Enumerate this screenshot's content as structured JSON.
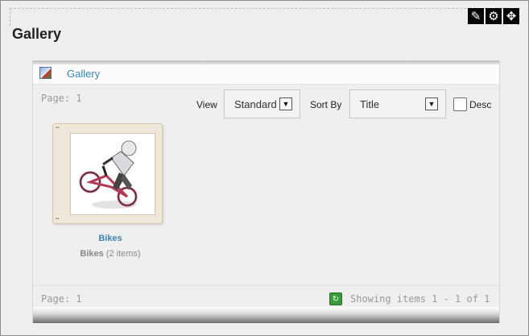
{
  "section": {
    "title": "Gallery"
  },
  "tools": [
    {
      "name": "edit",
      "icon": "pencil-icon",
      "glyph": "✎"
    },
    {
      "name": "settings",
      "icon": "gear-icon",
      "glyph": "⚙"
    },
    {
      "name": "move",
      "icon": "move-icon",
      "glyph": "✥"
    }
  ],
  "breadcrumb": {
    "label": "Gallery",
    "icon": "picture-icon"
  },
  "pager": {
    "top_label": "Page: 1",
    "bottom_label": "Page: 1",
    "showing": "Showing items 1 - 1 of 1"
  },
  "toolbar": {
    "view_label": "View",
    "view_value": "Standard",
    "sort_label": "Sort By",
    "sort_value": "Title",
    "desc_label": "Desc",
    "desc_checked": false
  },
  "items": [
    {
      "name": "Bikes",
      "caption_bold": "Bikes",
      "caption_rest": "(2 items)"
    }
  ],
  "colors": {
    "link": "#3f86b0",
    "toolbar_icon_bg": "#050505",
    "refresh_green": "#3a9a3a"
  }
}
